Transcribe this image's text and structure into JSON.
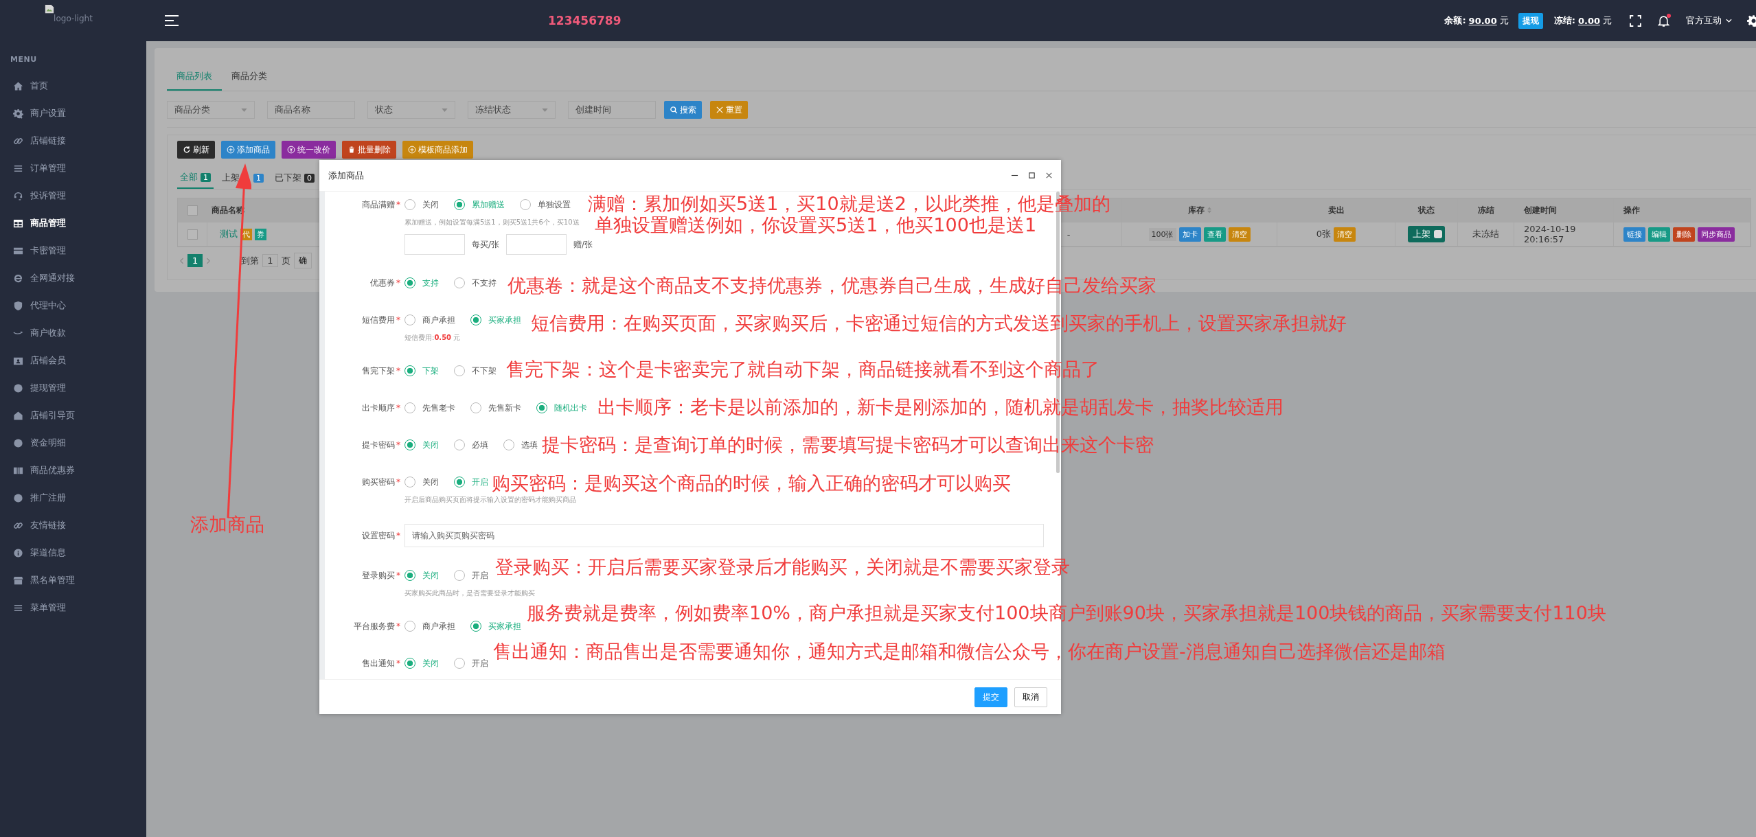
{
  "sidebar": {
    "logo_alt": "logo-light",
    "menu_label": "MENU",
    "items": [
      {
        "label": "首页",
        "selected": false
      },
      {
        "label": "商户设置",
        "selected": false
      },
      {
        "label": "店铺链接",
        "selected": false
      },
      {
        "label": "订单管理",
        "selected": false
      },
      {
        "label": "投诉管理",
        "selected": false
      },
      {
        "label": "商品管理",
        "selected": true
      },
      {
        "label": "卡密管理",
        "selected": false
      },
      {
        "label": "全网通对接",
        "selected": false
      },
      {
        "label": "代理中心",
        "selected": false
      },
      {
        "label": "商户收款",
        "selected": false
      },
      {
        "label": "店铺会员",
        "selected": false
      },
      {
        "label": "提现管理",
        "selected": false
      },
      {
        "label": "店铺引导页",
        "selected": false
      },
      {
        "label": "资金明细",
        "selected": false
      },
      {
        "label": "商品优惠券",
        "selected": false
      },
      {
        "label": "推广注册",
        "selected": false
      },
      {
        "label": "友情链接",
        "selected": false
      },
      {
        "label": "渠道信息",
        "selected": false
      },
      {
        "label": "黑名单管理",
        "selected": false
      },
      {
        "label": "菜单管理",
        "selected": false
      }
    ]
  },
  "topbar": {
    "site_name": "123456789",
    "balance_label": "余额:",
    "balance": "90.00",
    "balance_unit": "元",
    "withdraw_button": "提现",
    "frozen_label": "冻结:",
    "frozen": "0.00",
    "frozen_unit": "元",
    "notification": true,
    "user": "官方互动"
  },
  "page": {
    "tabs": [
      {
        "label": "商品列表",
        "selected": true
      },
      {
        "label": "商品分类",
        "selected": false
      }
    ],
    "filters": [
      {
        "kind": "select",
        "placeholder": "商品分类"
      },
      {
        "kind": "input",
        "placeholder": "商品名称"
      },
      {
        "kind": "select",
        "placeholder": "状态"
      },
      {
        "kind": "select",
        "placeholder": "冻结状态"
      },
      {
        "kind": "input",
        "placeholder": "创建时间"
      }
    ],
    "filter_buttons": [
      {
        "label": "搜索",
        "color": "#2d84c8"
      },
      {
        "label": "重置",
        "color": "#c7860f"
      }
    ],
    "toolbar": [
      {
        "label": "刷新",
        "color": "#2b2b2b"
      },
      {
        "label": "添加商品",
        "color": "#2d84c8"
      },
      {
        "label": "统一改价",
        "color": "#8a2c9e"
      },
      {
        "label": "批量删除",
        "color": "#c0441e"
      },
      {
        "label": "模板商品添加",
        "color": "#c7860f"
      }
    ],
    "status_tabs": [
      {
        "label": "全部",
        "count": "1",
        "selected": true
      },
      {
        "label": "上架",
        "count": "1",
        "selected": false
      },
      {
        "label": "已下架",
        "count": "0",
        "selected": false
      }
    ],
    "table": {
      "select_all": false,
      "columns": [
        "商品名称",
        "库存",
        "卖出",
        "状态",
        "冻结",
        "创建时间",
        "操作"
      ],
      "rows": [
        {
          "checked": false,
          "name": "测试",
          "tags": [
            "代",
            "券"
          ],
          "fee": "-",
          "stock": "100张",
          "stock_actions": [
            "加卡",
            "查看",
            "清空"
          ],
          "sold": "0张",
          "sold_action": "清空",
          "status": "上架",
          "on": true,
          "frozen": "未冻结",
          "created": "2024-10-19 20:16:57",
          "actions": [
            {
              "label": "链接",
              "color": "#2d84c8"
            },
            {
              "label": "编辑",
              "color": "#179a86"
            },
            {
              "label": "删除",
              "color": "#c0441e"
            },
            {
              "label": "同步商品",
              "color": "#8a2c9e"
            }
          ]
        }
      ]
    },
    "pagination": {
      "page": "1",
      "goto_label": "到第",
      "goto_value": "1",
      "page_unit": "页",
      "confirm": "确"
    }
  },
  "dialog": {
    "title": "添加商品",
    "fields": [
      {
        "kind": "radio",
        "label": "商品满赠",
        "required_mark": "*",
        "options": [
          {
            "label": "关闭",
            "selected": false
          },
          {
            "label": "累加赠送",
            "selected": true
          },
          {
            "label": "单独设置",
            "selected": false
          }
        ],
        "hint": "累加赠送，例如设置每满5送1，则买5送1共6个，买10送",
        "inputs": [
          "每买/张",
          "赠/张"
        ]
      },
      {
        "kind": "radio",
        "label": "优惠券",
        "required_mark": "*",
        "options": [
          {
            "label": "支持",
            "selected": true
          },
          {
            "label": "不支持",
            "selected": false
          }
        ]
      },
      {
        "kind": "radio",
        "label": "短信费用",
        "required_mark": "*",
        "options": [
          {
            "label": "商户承担",
            "selected": false
          },
          {
            "label": "买家承担",
            "selected": true
          }
        ],
        "fee": {
          "label": "短信费用:",
          "value": "0.50",
          "unit": "元"
        }
      },
      {
        "kind": "radio",
        "label": "售完下架",
        "required_mark": "*",
        "options": [
          {
            "label": "下架",
            "selected": true
          },
          {
            "label": "不下架",
            "selected": false
          }
        ]
      },
      {
        "kind": "radio",
        "label": "出卡顺序",
        "required_mark": "*",
        "options": [
          {
            "label": "先售老卡",
            "selected": false
          },
          {
            "label": "先售新卡",
            "selected": false
          },
          {
            "label": "随机出卡",
            "selected": true
          }
        ]
      },
      {
        "kind": "radio",
        "label": "提卡密码",
        "required_mark": "*",
        "options": [
          {
            "label": "关闭",
            "selected": true
          },
          {
            "label": "必填",
            "selected": false
          },
          {
            "label": "选填",
            "selected": false
          }
        ]
      },
      {
        "kind": "radio",
        "label": "购买密码",
        "required_mark": "*",
        "options": [
          {
            "label": "关闭",
            "selected": false
          },
          {
            "label": "开启",
            "selected": true
          }
        ],
        "hint": "开启后商品购买页面将提示输入设置的密码才能购买商品"
      },
      {
        "kind": "text",
        "label": "设置密码",
        "required_mark": "*",
        "placeholder": "请输入购买页购买密码"
      },
      {
        "kind": "radio",
        "label": "登录购买",
        "required_mark": "*",
        "options": [
          {
            "label": "关闭",
            "selected": true
          },
          {
            "label": "开启",
            "selected": false
          }
        ],
        "hint": "买家购买此商品时，是否需要登录才能购买"
      },
      {
        "kind": "radio",
        "label": "平台服务费",
        "required_mark": "*",
        "options": [
          {
            "label": "商户承担",
            "selected": false
          },
          {
            "label": "买家承担",
            "selected": true
          }
        ]
      },
      {
        "kind": "radio",
        "label": "售出通知",
        "required_mark": "*",
        "options": [
          {
            "label": "关闭",
            "selected": true
          },
          {
            "label": "开启",
            "selected": false
          }
        ]
      }
    ],
    "buttons": [
      {
        "label": "提交",
        "kind": "primary"
      },
      {
        "label": "取消",
        "kind": "default"
      }
    ]
  },
  "annotations": [
    {
      "text": "满赠：累加例如买5送1，买10就是送2，以此类推，他是叠加的"
    },
    {
      "text": "单独设置赠送例如，你设置买5送1，他买100也是送1"
    },
    {
      "text": "优惠卷：就是这个商品支不支持优惠券，优惠券自己生成，生成好自己发给买家"
    },
    {
      "text": "短信费用：在购买页面，买家购买后，卡密通过短信的方式发送到买家的手机上，设置买家承担就好"
    },
    {
      "text": "售完下架：这个是卡密卖完了就自动下架，商品链接就看不到这个商品了"
    },
    {
      "text": "出卡顺序：老卡是以前添加的，新卡是刚添加的，随机就是胡乱发卡，抽奖比较适用"
    },
    {
      "text": "提卡密码：是查询订单的时候，需要填写提卡密码才可以查询出来这个卡密"
    },
    {
      "text": "购买密码：是购买这个商品的时候，输入正确的密码才可以购买"
    },
    {
      "text": "登录购买：开启后需要买家登录后才能购买，关闭就是不需要买家登录"
    },
    {
      "text": "服务费就是费率，例如费率10%，商户承担就是买家支付100块商户到账90块，买家承担就是100块钱的商品，买家需要支付110块"
    },
    {
      "text": "售出通知：商品售出是否需要通知你，通知方式是邮箱和微信公众号，你在商户设置-消息通知自己选择微信还是邮箱"
    },
    {
      "text": "添加商品"
    }
  ]
}
